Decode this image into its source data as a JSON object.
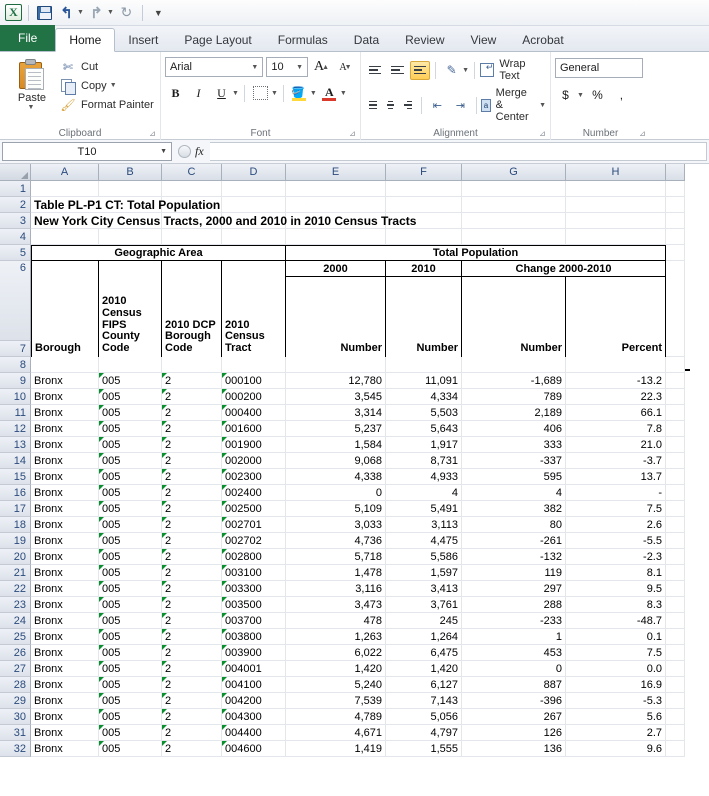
{
  "app": {
    "quick_access": {
      "logo": "X",
      "save": "save-icon",
      "undo": "undo-icon",
      "redo": "redo-icon",
      "refresh": "refresh-icon",
      "customize": "customize-icon"
    },
    "tabs": [
      {
        "label": "File",
        "active": false,
        "file": true
      },
      {
        "label": "Home",
        "active": true,
        "file": false
      },
      {
        "label": "Insert",
        "active": false,
        "file": false
      },
      {
        "label": "Page Layout",
        "active": false,
        "file": false
      },
      {
        "label": "Formulas",
        "active": false,
        "file": false
      },
      {
        "label": "Data",
        "active": false,
        "file": false
      },
      {
        "label": "Review",
        "active": false,
        "file": false
      },
      {
        "label": "View",
        "active": false,
        "file": false
      },
      {
        "label": "Acrobat",
        "active": false,
        "file": false
      }
    ]
  },
  "ribbon": {
    "clipboard": {
      "group_label": "Clipboard",
      "paste": "Paste",
      "cut": "Cut",
      "copy": "Copy",
      "format_painter": "Format Painter"
    },
    "font": {
      "group_label": "Font",
      "font_name": "Arial",
      "font_size": "10",
      "grow": "A",
      "shrink": "A",
      "bold": "B",
      "italic": "I",
      "underline": "U",
      "font_color_letter": "A"
    },
    "alignment": {
      "group_label": "Alignment",
      "wrap_text": "Wrap Text",
      "merge_center": "Merge & Center"
    },
    "number": {
      "group_label": "Number",
      "format": "General",
      "currency": "$",
      "percent": "%",
      "comma": ","
    }
  },
  "formula_bar": {
    "name_box": "T10",
    "formula": ""
  },
  "sheet": {
    "columns": [
      "A",
      "B",
      "C",
      "D",
      "E",
      "F",
      "G",
      "H"
    ],
    "titles": {
      "row2": "Table PL-P1 CT:  Total Population",
      "row3": "New York City Census Tracts, 2000 and 2010 in 2010 Census Tracts"
    },
    "header": {
      "geographic_area": "Geographic Area",
      "total_population": "Total Population",
      "year_2000": "2000",
      "year_2010": "2010",
      "change": "Change 2000-2010",
      "col_a": "Borough",
      "col_b": "2010 Census FIPS County Code",
      "col_c": "2010 DCP Borough Code",
      "col_d": "2010 Census Tract",
      "col_e": "Number",
      "col_f": "Number",
      "col_g": "Number",
      "col_h": "Percent"
    },
    "first_row_number": 1,
    "data_start_row": 9,
    "rows": [
      {
        "n": 9,
        "borough": "Bronx",
        "fips": "005",
        "dcp": "2",
        "tract": "000100",
        "p2000": "12,780",
        "p2010": "11,091",
        "chg": "-1,689",
        "pct": "-13.2"
      },
      {
        "n": 10,
        "borough": "Bronx",
        "fips": "005",
        "dcp": "2",
        "tract": "000200",
        "p2000": "3,545",
        "p2010": "4,334",
        "chg": "789",
        "pct": "22.3"
      },
      {
        "n": 11,
        "borough": "Bronx",
        "fips": "005",
        "dcp": "2",
        "tract": "000400",
        "p2000": "3,314",
        "p2010": "5,503",
        "chg": "2,189",
        "pct": "66.1"
      },
      {
        "n": 12,
        "borough": "Bronx",
        "fips": "005",
        "dcp": "2",
        "tract": "001600",
        "p2000": "5,237",
        "p2010": "5,643",
        "chg": "406",
        "pct": "7.8"
      },
      {
        "n": 13,
        "borough": "Bronx",
        "fips": "005",
        "dcp": "2",
        "tract": "001900",
        "p2000": "1,584",
        "p2010": "1,917",
        "chg": "333",
        "pct": "21.0"
      },
      {
        "n": 14,
        "borough": "Bronx",
        "fips": "005",
        "dcp": "2",
        "tract": "002000",
        "p2000": "9,068",
        "p2010": "8,731",
        "chg": "-337",
        "pct": "-3.7"
      },
      {
        "n": 15,
        "borough": "Bronx",
        "fips": "005",
        "dcp": "2",
        "tract": "002300",
        "p2000": "4,338",
        "p2010": "4,933",
        "chg": "595",
        "pct": "13.7"
      },
      {
        "n": 16,
        "borough": "Bronx",
        "fips": "005",
        "dcp": "2",
        "tract": "002400",
        "p2000": "0",
        "p2010": "4",
        "chg": "4",
        "pct": "-"
      },
      {
        "n": 17,
        "borough": "Bronx",
        "fips": "005",
        "dcp": "2",
        "tract": "002500",
        "p2000": "5,109",
        "p2010": "5,491",
        "chg": "382",
        "pct": "7.5"
      },
      {
        "n": 18,
        "borough": "Bronx",
        "fips": "005",
        "dcp": "2",
        "tract": "002701",
        "p2000": "3,033",
        "p2010": "3,113",
        "chg": "80",
        "pct": "2.6"
      },
      {
        "n": 19,
        "borough": "Bronx",
        "fips": "005",
        "dcp": "2",
        "tract": "002702",
        "p2000": "4,736",
        "p2010": "4,475",
        "chg": "-261",
        "pct": "-5.5"
      },
      {
        "n": 20,
        "borough": "Bronx",
        "fips": "005",
        "dcp": "2",
        "tract": "002800",
        "p2000": "5,718",
        "p2010": "5,586",
        "chg": "-132",
        "pct": "-2.3"
      },
      {
        "n": 21,
        "borough": "Bronx",
        "fips": "005",
        "dcp": "2",
        "tract": "003100",
        "p2000": "1,478",
        "p2010": "1,597",
        "chg": "119",
        "pct": "8.1"
      },
      {
        "n": 22,
        "borough": "Bronx",
        "fips": "005",
        "dcp": "2",
        "tract": "003300",
        "p2000": "3,116",
        "p2010": "3,413",
        "chg": "297",
        "pct": "9.5"
      },
      {
        "n": 23,
        "borough": "Bronx",
        "fips": "005",
        "dcp": "2",
        "tract": "003500",
        "p2000": "3,473",
        "p2010": "3,761",
        "chg": "288",
        "pct": "8.3"
      },
      {
        "n": 24,
        "borough": "Bronx",
        "fips": "005",
        "dcp": "2",
        "tract": "003700",
        "p2000": "478",
        "p2010": "245",
        "chg": "-233",
        "pct": "-48.7"
      },
      {
        "n": 25,
        "borough": "Bronx",
        "fips": "005",
        "dcp": "2",
        "tract": "003800",
        "p2000": "1,263",
        "p2010": "1,264",
        "chg": "1",
        "pct": "0.1"
      },
      {
        "n": 26,
        "borough": "Bronx",
        "fips": "005",
        "dcp": "2",
        "tract": "003900",
        "p2000": "6,022",
        "p2010": "6,475",
        "chg": "453",
        "pct": "7.5"
      },
      {
        "n": 27,
        "borough": "Bronx",
        "fips": "005",
        "dcp": "2",
        "tract": "004001",
        "p2000": "1,420",
        "p2010": "1,420",
        "chg": "0",
        "pct": "0.0"
      },
      {
        "n": 28,
        "borough": "Bronx",
        "fips": "005",
        "dcp": "2",
        "tract": "004100",
        "p2000": "5,240",
        "p2010": "6,127",
        "chg": "887",
        "pct": "16.9"
      },
      {
        "n": 29,
        "borough": "Bronx",
        "fips": "005",
        "dcp": "2",
        "tract": "004200",
        "p2000": "7,539",
        "p2010": "7,143",
        "chg": "-396",
        "pct": "-5.3"
      },
      {
        "n": 30,
        "borough": "Bronx",
        "fips": "005",
        "dcp": "2",
        "tract": "004300",
        "p2000": "4,789",
        "p2010": "5,056",
        "chg": "267",
        "pct": "5.6"
      },
      {
        "n": 31,
        "borough": "Bronx",
        "fips": "005",
        "dcp": "2",
        "tract": "004400",
        "p2000": "4,671",
        "p2010": "4,797",
        "chg": "126",
        "pct": "2.7"
      },
      {
        "n": 32,
        "borough": "Bronx",
        "fips": "005",
        "dcp": "2",
        "tract": "004600",
        "p2000": "1,419",
        "p2010": "1,555",
        "chg": "136",
        "pct": "9.6"
      }
    ]
  },
  "colors": {
    "file_tab_green": "#217346",
    "header_blue": "#2b4b7d",
    "error_triangle_green": "#0a8f2e",
    "selected_highlight": "#ffcd56"
  }
}
